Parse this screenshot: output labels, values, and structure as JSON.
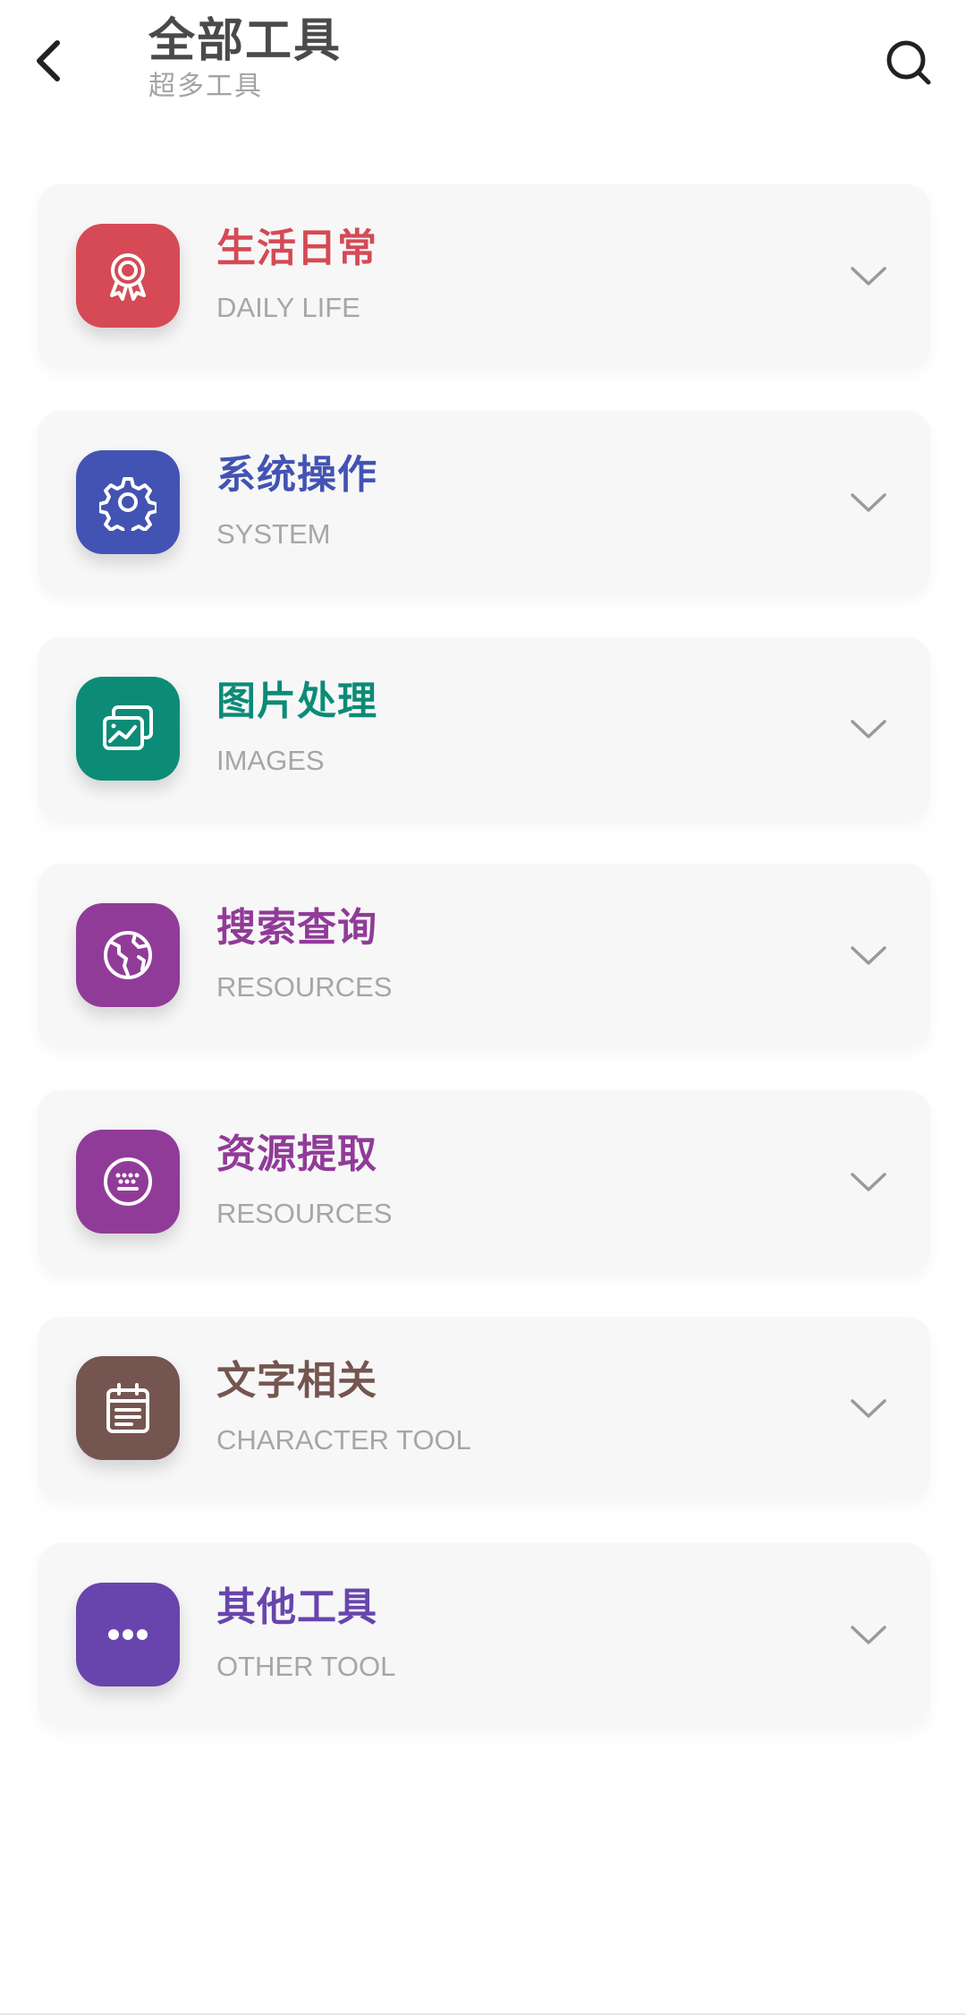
{
  "header": {
    "title": "全部工具",
    "subtitle": "超多工具",
    "back_icon": "chevron-left-icon",
    "search_icon": "search-icon"
  },
  "categories": [
    {
      "title": "生活日常",
      "subtitle": "DAILY LIFE",
      "color": "#d54a55",
      "icon": "award-ribbon-icon"
    },
    {
      "title": "系统操作",
      "subtitle": "SYSTEM",
      "color": "#4353b3",
      "icon": "gear-icon"
    },
    {
      "title": "图片处理",
      "subtitle": "IMAGES",
      "color": "#0c8b77",
      "icon": "image-gallery-icon"
    },
    {
      "title": "搜索查询",
      "subtitle": "RESOURCES",
      "color": "#913b99",
      "icon": "globe-icon"
    },
    {
      "title": "资源提取",
      "subtitle": "RESOURCES",
      "color": "#913b99",
      "icon": "keyboard-circle-icon"
    },
    {
      "title": "文字相关",
      "subtitle": "CHARACTER TOOL",
      "color": "#75554f",
      "icon": "clipboard-list-icon"
    },
    {
      "title": "其他工具",
      "subtitle": "OTHER TOOL",
      "color": "#6845ad",
      "icon": "more-dots-icon"
    }
  ],
  "colors": {
    "card_background": "#f7f7f7",
    "subtitle_gray": "#a6a6a6",
    "header_title": "#4a4a4a",
    "chevron": "#9a9a9a"
  }
}
